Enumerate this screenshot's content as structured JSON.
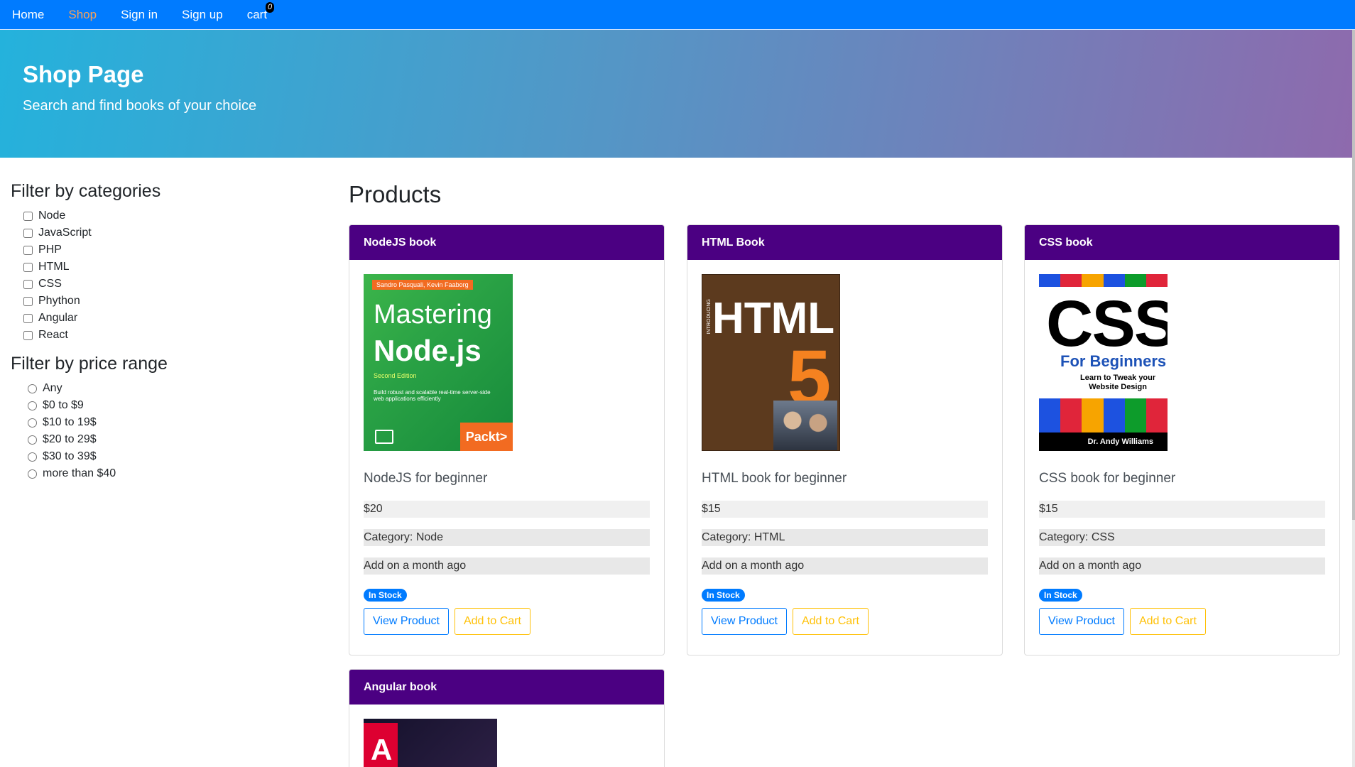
{
  "nav": {
    "items": [
      "Home",
      "Shop",
      "Sign in",
      "Sign up",
      "cart"
    ],
    "cart_count": "0",
    "active": "Shop"
  },
  "hero": {
    "title": "Shop Page",
    "subtitle": "Search and find books of your choice"
  },
  "sidebar": {
    "categories_title": "Filter by categories",
    "categories": [
      "Node",
      "JavaScript",
      "PHP",
      "HTML",
      "CSS",
      "Phython",
      "Angular",
      "React"
    ],
    "price_title": "Filter by price range",
    "prices": [
      "Any",
      "$0 to $9",
      "$10 to 19$",
      "$20 to 29$",
      "$30 to 39$",
      "more than $40"
    ]
  },
  "products": {
    "title": "Products",
    "items": [
      {
        "header": "NodeJS book",
        "cover": {
          "authors": "Sandro Pasquali, Kevin Faaborg",
          "line1": "Mastering",
          "line2": "Node.js",
          "edition": "Second Edition",
          "desc": "Build robust and scalable real-time server-side web applications efficiently",
          "publisher": "Packt>"
        },
        "title": "NodeJS for beginner",
        "price": "$20",
        "category": "Category: Node",
        "added": "Add on a month ago",
        "badge": "In Stock",
        "view": "View Product",
        "cart": "Add to Cart"
      },
      {
        "header": "HTML Book",
        "cover": {
          "intro": "INTRODUCING",
          "word": "HTML",
          "number": "5"
        },
        "title": "HTML book for beginner",
        "price": "$15",
        "category": "Category: HTML",
        "added": "Add on a month ago",
        "badge": "In Stock",
        "view": "View Product",
        "cart": "Add to Cart"
      },
      {
        "header": "CSS book",
        "cover": {
          "word": "CSS",
          "for": "For Beginners",
          "tag1": "Learn to Tweak your",
          "tag2": "Website Design",
          "author": "Dr. Andy Williams"
        },
        "title": "CSS book for beginner",
        "price": "$15",
        "category": "Category: CSS",
        "added": "Add on a month ago",
        "badge": "In Stock",
        "view": "View Product",
        "cart": "Add to Cart"
      },
      {
        "header": "Angular book",
        "cover": {
          "letter": "A"
        }
      }
    ]
  },
  "colors": {
    "nav": "#007bff",
    "active_nav": "#f8a35a",
    "card_header": "#4b0082",
    "badge": "#007bff",
    "view_button": "#007bff",
    "cart_button": "#ffc107"
  }
}
